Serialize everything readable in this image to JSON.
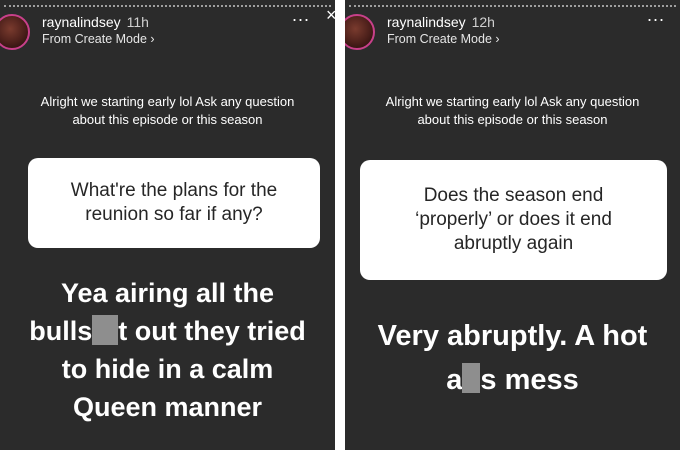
{
  "stories": [
    {
      "username": "raynalindsey",
      "time": "11h",
      "subline": "From Create Mode",
      "subline_chevron": "›",
      "more_icon": "...",
      "close_icon": "×",
      "prompt": "Alright we starting early lol Ask any question about this episode or this season",
      "question": "What're the plans for the reunion so far if any?",
      "answer_line1": "Yea airing all the",
      "answer_line2_a": "bulls",
      "answer_line2_b": "t out they tried",
      "answer_line3": "to hide in a calm",
      "answer_line4": "Queen manner"
    },
    {
      "username": "raynalindsey",
      "time": "12h",
      "subline": "From Create Mode",
      "subline_chevron": "›",
      "more_icon": "...",
      "prompt": "Alright we starting early lol Ask any question about this episode or this season",
      "question": "Does the season end ‘properly’ or does it end abruptly again",
      "answer_line1": "Very abruptly. A hot",
      "answer_line2_a": "a",
      "answer_line2_b": "s mess"
    }
  ],
  "colors": {
    "story_bg": "#2b2b2b",
    "card_bg": "#ffffff",
    "censor_block": "#8e8e8e",
    "avatar_ring": "#c8408a"
  }
}
